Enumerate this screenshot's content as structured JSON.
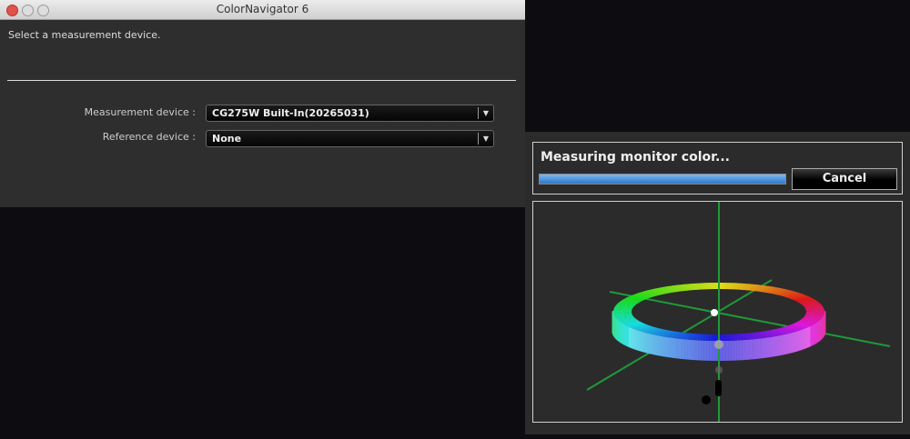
{
  "window": {
    "title": "ColorNavigator 6",
    "prompt": "Select a measurement device."
  },
  "form": {
    "measurement_label": "Measurement device :",
    "measurement_value": "CG275W Built-In(20265031)",
    "reference_label": "Reference device :",
    "reference_value": "None",
    "dropdown_arrow": "▼"
  },
  "measure": {
    "status": "Measuring monitor color...",
    "progress_percent": 100,
    "cancel_label": "Cancel"
  },
  "colors": {
    "axis": "#1f9a3a",
    "progress": "#3b8ad6"
  }
}
